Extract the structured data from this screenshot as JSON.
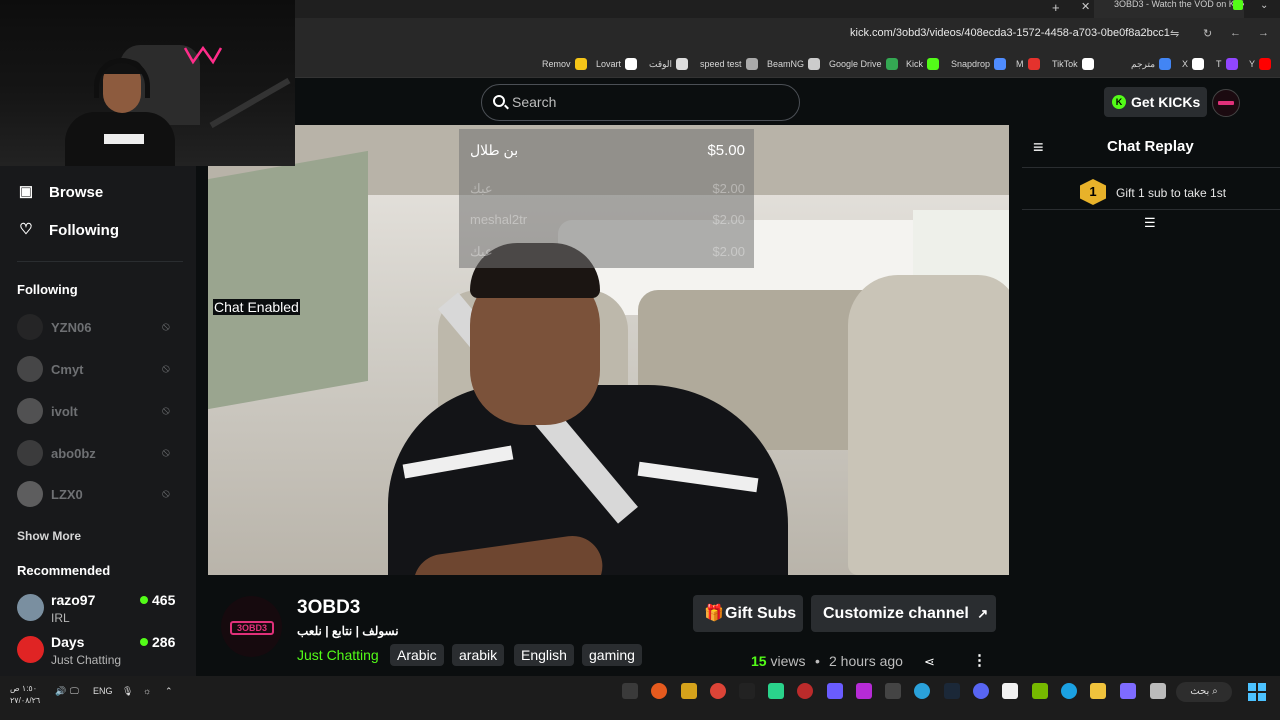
{
  "browser": {
    "active_tab_title": "3OBD3 - Watch the VOD on Kick",
    "url": "kick.com/3obd3/videos/408ecda3-1572-4458-a703-0be0f8a2bcc1",
    "bookmarks": [
      {
        "label": "Remov",
        "color": "#f5c518"
      },
      {
        "label": "Lovart",
        "color": "#ffffff"
      },
      {
        "label": "الوقت",
        "color": "#dddddd"
      },
      {
        "label": "speed test",
        "color": "#aaaaaa"
      },
      {
        "label": "BeamNG",
        "color": "#cccccc"
      },
      {
        "label": "Google Drive",
        "color": "#34a853"
      },
      {
        "label": "Kick",
        "color": "#53fc18"
      },
      {
        "label": "Snapdrop",
        "color": "#4f8cff"
      },
      {
        "label": "M",
        "color": "#e5322d"
      },
      {
        "label": "TikTok",
        "color": "#ffffff"
      },
      {
        "label": "مترجم",
        "color": "#4285f4"
      },
      {
        "label": "X",
        "color": "#ffffff"
      },
      {
        "label": "T",
        "color": "#9146ff"
      },
      {
        "label": "Y",
        "color": "#ff0000"
      }
    ]
  },
  "header": {
    "search_placeholder": "Search",
    "get_kicks_label": "Get KICKs"
  },
  "sidebar": {
    "nav": [
      {
        "label": "Browse",
        "icon": "browse-icon"
      },
      {
        "label": "Following",
        "icon": "heart-icon"
      }
    ],
    "following_title": "Following",
    "following": [
      {
        "name": "YZN06",
        "status": "offline"
      },
      {
        "name": "Cmyt",
        "status": "offline"
      },
      {
        "name": "ivolt",
        "status": "offline"
      },
      {
        "name": "abo0bz",
        "status": "offline"
      },
      {
        "name": "LZX0",
        "status": "offline"
      }
    ],
    "show_more": "Show More",
    "recommended_title": "Recommended",
    "recommended": [
      {
        "name": "razo97",
        "category": "IRL",
        "viewers": "465"
      },
      {
        "name": "Days",
        "category": "Just Chatting",
        "viewers": "286"
      }
    ]
  },
  "video": {
    "chat_enabled_label": "Chat Enabled",
    "donations": [
      {
        "name": "بن طلال",
        "amount": "$5.00"
      },
      {
        "name": "عبك",
        "amount": "$2.00"
      },
      {
        "name": "meshal2tr",
        "amount": "$2.00"
      },
      {
        "name": "عبك",
        "amount": "$2.00"
      }
    ]
  },
  "channel": {
    "name": "3OBD3",
    "logo_text": "3OBD3",
    "title": "نسولف | نتابع | نلعب",
    "category": "Just Chatting",
    "tags": [
      "Arabic",
      "arabik",
      "English",
      "gaming"
    ],
    "gift_subs_label": "Gift Subs",
    "customize_label": "Customize channel",
    "views_count": "15",
    "views_label": "views",
    "time_ago": "2 hours ago"
  },
  "chat": {
    "title": "Chat Replay",
    "gift_badge": "1",
    "gift_text": "Gift 1 sub to take 1st"
  },
  "taskbar": {
    "time": "١:٥٠ ص",
    "date": "٢٧/٠٨/٢٦",
    "lang": "ENG",
    "search_label": "بحث"
  },
  "colors": {
    "kick_green": "#53fc18",
    "brand_pink": "#e0317a",
    "gift_gold": "#e8b22a"
  }
}
